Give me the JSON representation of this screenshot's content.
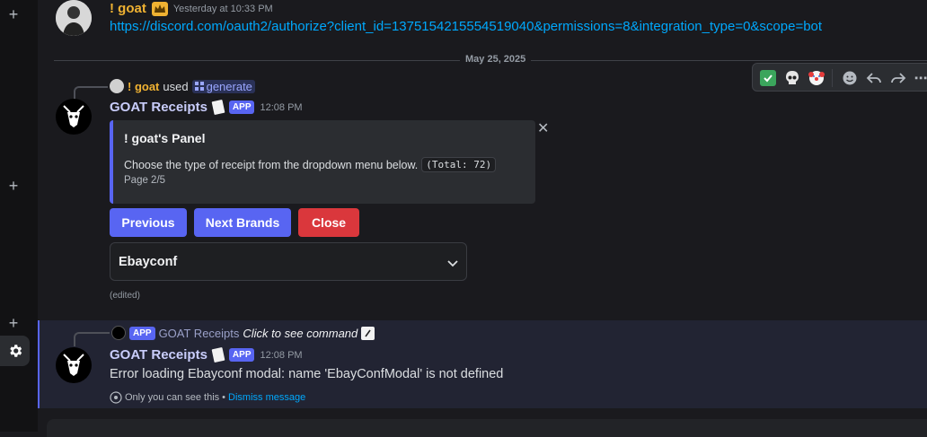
{
  "message1": {
    "username": "! goat",
    "timestamp": "Yesterday at 10:33 PM",
    "link": "https://discord.com/oauth2/authorize?client_id=1375154215554519040&permissions=8&integration_type=0&scope=bot"
  },
  "date_divider": "May 25, 2025",
  "hover_toolbar": {
    "icons": [
      "check-emoji-icon",
      "skull-emoji-icon",
      "clown-emoji-icon",
      "add-reaction-icon",
      "reply-icon",
      "forward-icon",
      "more-icon"
    ]
  },
  "message2": {
    "reply_user": "! goat",
    "reply_used": "used",
    "reply_command": "generate",
    "bot_name": "GOAT Receipts",
    "app_badge": "APP",
    "timestamp": "12:08 PM",
    "embed": {
      "title": "! goat's Panel",
      "description": "Choose the type of receipt from the dropdown menu below.",
      "code": "(Total: 72)",
      "footer": "Page 2/5"
    },
    "buttons": {
      "previous": "Previous",
      "next": "Next Brands",
      "close": "Close"
    },
    "select_value": "Ebayconf",
    "edited": "(edited)",
    "colors": {
      "blurple": "#5865f2",
      "danger": "#da373c",
      "username": "#f0b232"
    }
  },
  "message3": {
    "reply_app_badge": "APP",
    "reply_bot": "GOAT Receipts",
    "reply_action": "Click to see command",
    "bot_name": "GOAT Receipts",
    "app_badge": "APP",
    "timestamp": "12:08 PM",
    "text": "Error loading Ebayconf modal: name 'EbayConfModal' is not defined",
    "only_you": "Only you can see this",
    "bullet": " • ",
    "dismiss": "Dismiss message"
  }
}
